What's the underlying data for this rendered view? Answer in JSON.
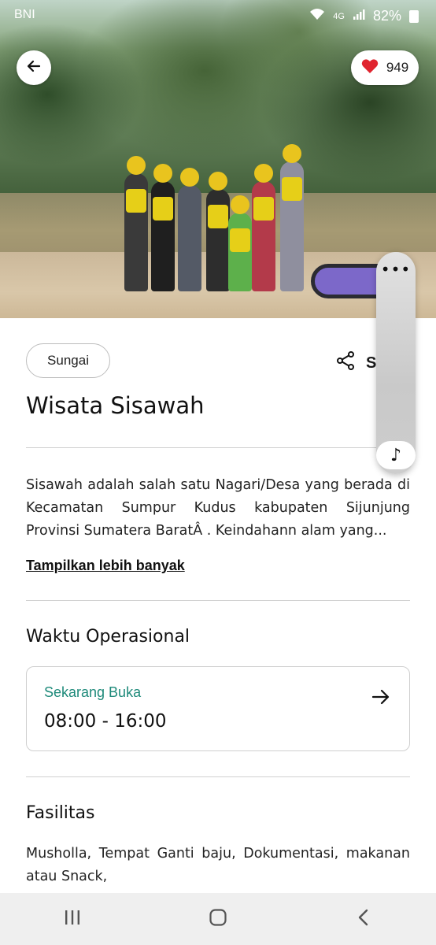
{
  "status_bar": {
    "left_text": "BNI",
    "network": "4G",
    "battery": "82%"
  },
  "header": {
    "like_count": "949"
  },
  "place": {
    "category": "Sungai",
    "share_label": "S",
    "title": "Wisata Sisawah",
    "description": "Sisawah adalah salah satu Nagari/Desa yang berada di Kecamatan Sumpur Kudus kabupaten Sijunjung Provinsi Sumatera BaratÂ . Keindahann alam yang...",
    "show_more": "Tampilkan lebih banyak"
  },
  "operational": {
    "heading": "Waktu Operasional",
    "status": "Sekarang Buka",
    "hours": "08:00 - 16:00"
  },
  "facilities": {
    "heading": "Fasilitas",
    "text": "Musholla, Tempat Ganti baju, Dokumentasi, makanan atau Snack,"
  },
  "floating_panel": {
    "more_glyph": "•••",
    "music_glyph": "♪"
  },
  "colors": {
    "accent_teal": "#1e8a7a",
    "heart_red": "#e0242f"
  }
}
